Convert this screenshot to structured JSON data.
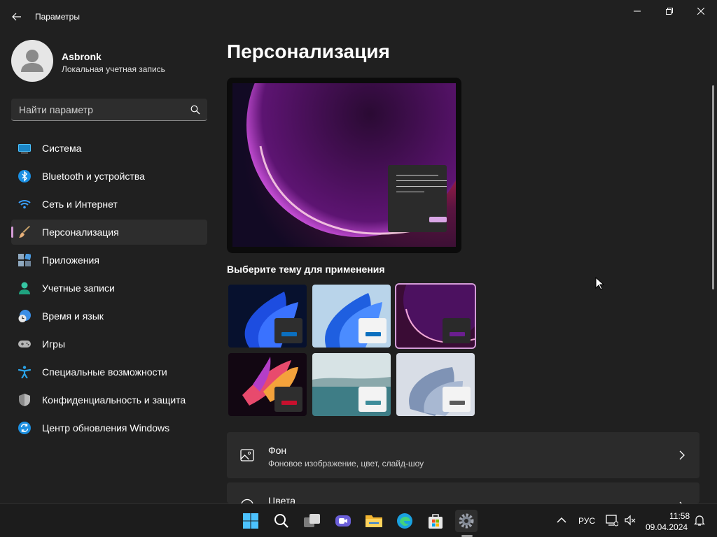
{
  "window": {
    "title": "Параметры"
  },
  "profile": {
    "name": "Asbronk",
    "account_type": "Локальная учетная запись"
  },
  "search": {
    "placeholder": "Найти параметр"
  },
  "sidebar": {
    "items": [
      {
        "label": "Система",
        "icon": "monitor-icon"
      },
      {
        "label": "Bluetooth и устройства",
        "icon": "bluetooth-icon"
      },
      {
        "label": "Сеть и Интернет",
        "icon": "wifi-icon"
      },
      {
        "label": "Персонализация",
        "icon": "brush-icon",
        "active": true
      },
      {
        "label": "Приложения",
        "icon": "apps-icon"
      },
      {
        "label": "Учетные записи",
        "icon": "person-icon"
      },
      {
        "label": "Время и язык",
        "icon": "globe-clock-icon"
      },
      {
        "label": "Игры",
        "icon": "gamepad-icon"
      },
      {
        "label": "Специальные возможности",
        "icon": "accessibility-icon"
      },
      {
        "label": "Конфиденциальность и защита",
        "icon": "shield-icon"
      },
      {
        "label": "Центр обновления Windows",
        "icon": "update-icon"
      }
    ]
  },
  "main": {
    "title": "Персонализация",
    "themes_label": "Выберите тему для применения",
    "themes": [
      {
        "name": "windows-dark-bloom",
        "chip_color": "#2e2e2e",
        "bar_color": "#0b6fbf"
      },
      {
        "name": "windows-light-bloom",
        "chip_color": "#f3f3f3",
        "bar_color": "#0b6fbf"
      },
      {
        "name": "glow",
        "chip_color": "#2a2a2a",
        "bar_color": "#6b1e8f",
        "selected": true
      },
      {
        "name": "captured-motion",
        "chip_color": "#2e2e2e",
        "bar_color": "#c8102e"
      },
      {
        "name": "sunrise",
        "chip_color": "#f3f3f3",
        "bar_color": "#3d8c9a"
      },
      {
        "name": "flow",
        "chip_color": "#f3f3f3",
        "bar_color": "#5b5b5b"
      }
    ],
    "cards": [
      {
        "title": "Фон",
        "subtitle": "Фоновое изображение, цвет, слайд-шоу",
        "icon": "picture-icon"
      },
      {
        "title": "Цвета",
        "subtitle": "",
        "icon": "palette-icon"
      }
    ]
  },
  "taskbar": {
    "apps": [
      "start-icon",
      "search-icon",
      "task-view-icon",
      "meet-icon",
      "file-explorer-icon",
      "edge-icon",
      "store-icon",
      "settings-icon"
    ],
    "language": "РУС",
    "time": "11:58",
    "date": "09.04.2024"
  },
  "colors": {
    "accent": "#d39bd6",
    "background": "#202020",
    "card": "#2b2b2b"
  }
}
